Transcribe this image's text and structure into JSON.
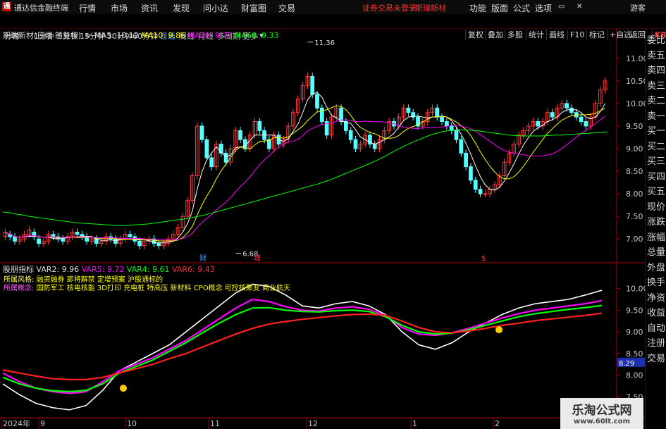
{
  "app": {
    "logo": "通",
    "title": "通达信金融终端",
    "menu": [
      "行情",
      "市场",
      "资讯",
      "发现",
      "问小达",
      "财富圈",
      "交易"
    ],
    "warning": "证券交易未登录",
    "stock_name_top": "斯瑞新材",
    "right_menu": [
      "功能",
      "版面",
      "公式",
      "选项"
    ],
    "guest": "游客"
  },
  "toolbar": {
    "periods": [
      "分时",
      "1分钟",
      "5分钟",
      "15分钟",
      "30分钟",
      "60分钟",
      "日线",
      "周线",
      "月线",
      "多周期",
      "更多"
    ],
    "active_period": "日线",
    "right_buttons": [
      "复权",
      "叠加",
      "多股",
      "统计",
      "画线",
      "F10",
      "标记",
      "+自选",
      "返回"
    ],
    "kr": "KR"
  },
  "sidebar": [
    "委比",
    "卖五",
    "卖四",
    "卖三",
    "卖二",
    "卖一",
    "买一",
    "买二",
    "买三",
    "买四",
    "买五",
    "现价",
    "涨跌",
    "涨幅",
    "总量",
    "外盘",
    "换手",
    "净资",
    "收益",
    "自动",
    "注册",
    "交易"
  ],
  "colors": {
    "up": "#ff3b3b",
    "down": "#54ffff",
    "ma5": "#ffffff",
    "ma10": "#ffff00",
    "ma20": "#ff00ff",
    "ma60": "#00ff00",
    "axis": "#b00000"
  },
  "chart_data": [
    {
      "type": "candlestick",
      "title": "斯瑞新材(日线 前复权)",
      "legend": [
        {
          "label": "MA5: 10.12",
          "color": "#ffffff"
        },
        {
          "label": "MA10: 9.86",
          "color": "#ffff00"
        },
        {
          "label": "MA20: 9.77",
          "color": "#ff00ff"
        },
        {
          "label": "MA60: 9.33",
          "color": "#00ff00"
        }
      ],
      "ylim": [
        6.55,
        11.45
      ],
      "y_ticks": [
        "11.00",
        "10.50",
        "10.00",
        "9.50",
        "9.00",
        "8.50",
        "8.00",
        "7.50",
        "7.00"
      ],
      "y_tick_values": [
        11.0,
        10.5,
        10.0,
        9.5,
        9.0,
        8.5,
        8.0,
        7.5,
        7.0
      ],
      "annotations": [
        {
          "text": "11.36",
          "price": 11.36
        },
        {
          "text": "6.68",
          "price": 6.68
        }
      ],
      "markers": [
        "财",
        "增",
        "$"
      ],
      "closes": [
        7.15,
        7.05,
        6.95,
        7.0,
        7.1,
        7.2,
        7.05,
        6.9,
        6.95,
        7.1,
        7.05,
        7.0,
        6.95,
        7.05,
        7.15,
        7.1,
        7.05,
        6.95,
        7.0,
        6.9,
        6.95,
        7.05,
        7.0,
        6.9,
        7.0,
        7.1,
        7.05,
        6.95,
        6.85,
        6.95,
        7.0,
        6.9,
        6.85,
        6.9,
        7.0,
        7.1,
        7.25,
        7.5,
        7.85,
        8.4,
        9.5,
        9.2,
        8.8,
        8.6,
        9.1,
        8.9,
        8.7,
        9.0,
        9.4,
        9.2,
        9.0,
        9.3,
        9.6,
        9.4,
        9.2,
        9.0,
        9.3,
        9.1,
        9.2,
        9.5,
        9.8,
        10.1,
        10.4,
        10.6,
        10.2,
        9.9,
        9.6,
        9.3,
        9.7,
        9.9,
        9.6,
        9.4,
        9.2,
        9.0,
        9.1,
        9.3,
        9.1,
        9.0,
        9.2,
        9.4,
        9.6,
        9.5,
        9.7,
        9.9,
        9.8,
        9.7,
        9.5,
        9.6,
        9.8,
        9.9,
        9.7,
        9.6,
        9.5,
        9.4,
        9.2,
        8.9,
        8.6,
        8.3,
        8.1,
        8.0,
        8.0,
        8.1,
        8.2,
        8.4,
        8.7,
        8.9,
        9.1,
        9.3,
        9.4,
        9.5,
        9.6,
        9.5,
        9.6,
        9.8,
        9.7,
        9.9,
        10.0,
        9.9,
        9.8,
        9.7,
        9.6,
        9.5,
        9.7,
        10.0,
        10.3,
        10.5
      ],
      "opens": [
        7.05,
        7.1,
        7.05,
        6.95,
        7.0,
        7.1,
        7.15,
        7.0,
        6.9,
        6.95,
        7.1,
        7.05,
        7.0,
        6.95,
        7.05,
        7.15,
        7.1,
        7.05,
        6.95,
        7.0,
        6.9,
        6.95,
        7.05,
        7.0,
        6.9,
        7.0,
        7.1,
        7.05,
        6.95,
        6.85,
        6.95,
        7.0,
        6.9,
        6.85,
        6.9,
        7.0,
        7.1,
        7.25,
        7.5,
        7.85,
        8.4,
        9.5,
        9.2,
        8.8,
        8.6,
        9.1,
        8.9,
        8.7,
        9.0,
        9.4,
        9.2,
        9.0,
        9.3,
        9.6,
        9.4,
        9.2,
        9.0,
        9.3,
        9.1,
        9.2,
        9.5,
        9.8,
        10.1,
        10.4,
        10.6,
        10.2,
        9.9,
        9.6,
        9.3,
        9.7,
        9.9,
        9.6,
        9.4,
        9.2,
        9.0,
        9.1,
        9.3,
        9.1,
        9.0,
        9.2,
        9.4,
        9.6,
        9.5,
        9.7,
        9.9,
        9.8,
        9.7,
        9.5,
        9.6,
        9.8,
        9.9,
        9.7,
        9.6,
        9.5,
        9.4,
        9.2,
        8.9,
        8.6,
        8.3,
        8.1,
        8.0,
        8.0,
        8.1,
        8.2,
        8.4,
        8.7,
        8.9,
        9.1,
        9.3,
        9.4,
        9.5,
        9.6,
        9.5,
        9.6,
        9.8,
        9.7,
        9.9,
        10.0,
        9.9,
        9.8,
        9.7,
        9.6,
        9.5,
        9.7,
        10.0,
        10.3
      ],
      "ma60": [
        7.6,
        7.58,
        7.55,
        7.53,
        7.5,
        7.48,
        7.46,
        7.44,
        7.42,
        7.4,
        7.38,
        7.36,
        7.35,
        7.34,
        7.33,
        7.32,
        7.31,
        7.3,
        7.3,
        7.3,
        7.31,
        7.32,
        7.33,
        7.35,
        7.37,
        7.39,
        7.41,
        7.43,
        7.45,
        7.48,
        7.51,
        7.54,
        7.58,
        7.62,
        7.66,
        7.7,
        7.74,
        7.78,
        7.82,
        7.86,
        7.9,
        7.94,
        7.98,
        8.02,
        8.06,
        8.1,
        8.14,
        8.18,
        8.22,
        8.27,
        8.32,
        8.38,
        8.44,
        8.5,
        8.56,
        8.62,
        8.68,
        8.75,
        8.82,
        8.9,
        8.98,
        9.05,
        9.12,
        9.18,
        9.24,
        9.3,
        9.34,
        9.38,
        9.4,
        9.42,
        9.42,
        9.41,
        9.4,
        9.38,
        9.36,
        9.34,
        9.32,
        9.3,
        9.29,
        9.28,
        9.28,
        9.28,
        9.28,
        9.29,
        9.3,
        9.3,
        9.31,
        9.32,
        9.33,
        9.34,
        9.35,
        9.36,
        9.37
      ]
    },
    {
      "type": "line",
      "title": "股朋指标",
      "legend": [
        {
          "label": "VAR2: 9.96",
          "color": "#ffffff"
        },
        {
          "label": "VAR5: 9.72",
          "color": "#ff00ff"
        },
        {
          "label": "VAR4: 9.61",
          "color": "#00ff00"
        },
        {
          "label": "VAR6: 9.43",
          "color": "#ff2020"
        }
      ],
      "ylim": [
        7.1,
        10.4
      ],
      "y_ticks": [
        "10.00",
        "9.50",
        "9.00",
        "8.50",
        "8.00",
        "7.50"
      ],
      "y_tick_values": [
        10.0,
        9.5,
        9.0,
        8.5,
        8.0,
        7.5
      ],
      "current_value": "8.29",
      "info_lines": [
        {
          "label": "所属风格:",
          "value": "融资融券 即将解禁 定增预案 沪股通标的"
        },
        {
          "label": "所属概念:",
          "value": "国防军工 核电核能 3D打印 充电桩 特高压 新材料 CPO概念 可控核聚变 商业航天"
        }
      ],
      "x_ticks": [
        "2024年",
        "9",
        "10",
        "11",
        "12",
        "1",
        "2"
      ],
      "series": [
        {
          "name": "VAR2",
          "values": [
            7.8,
            7.55,
            7.35,
            7.25,
            7.2,
            7.3,
            7.65,
            8.1,
            8.3,
            8.5,
            8.7,
            9.0,
            9.3,
            9.6,
            9.9,
            10.1,
            10.05,
            9.85,
            9.6,
            9.55,
            9.65,
            9.7,
            9.6,
            9.4,
            9.0,
            8.7,
            8.6,
            8.75,
            9.0,
            9.2,
            9.4,
            9.55,
            9.65,
            9.7,
            9.75,
            9.85,
            9.96
          ]
        },
        {
          "name": "VAR5",
          "values": [
            8.05,
            7.85,
            7.7,
            7.62,
            7.58,
            7.62,
            7.85,
            8.1,
            8.25,
            8.4,
            8.6,
            8.8,
            9.05,
            9.3,
            9.55,
            9.75,
            9.7,
            9.58,
            9.5,
            9.48,
            9.55,
            9.58,
            9.52,
            9.38,
            9.1,
            8.95,
            8.92,
            8.98,
            9.08,
            9.2,
            9.32,
            9.42,
            9.5,
            9.55,
            9.6,
            9.65,
            9.72
          ]
        },
        {
          "name": "VAR4",
          "values": [
            7.95,
            7.8,
            7.7,
            7.64,
            7.62,
            7.65,
            7.8,
            8.05,
            8.2,
            8.35,
            8.55,
            8.75,
            8.98,
            9.2,
            9.4,
            9.55,
            9.56,
            9.5,
            9.47,
            9.46,
            9.49,
            9.5,
            9.47,
            9.35,
            9.15,
            9.0,
            8.95,
            8.97,
            9.05,
            9.15,
            9.25,
            9.35,
            9.42,
            9.47,
            9.52,
            9.56,
            9.61
          ]
        },
        {
          "name": "VAR6",
          "values": [
            8.12,
            8.05,
            7.98,
            7.92,
            7.9,
            7.9,
            7.95,
            8.05,
            8.15,
            8.25,
            8.38,
            8.5,
            8.65,
            8.8,
            8.95,
            9.08,
            9.18,
            9.24,
            9.29,
            9.33,
            9.37,
            9.4,
            9.41,
            9.38,
            9.25,
            9.1,
            9.0,
            8.98,
            9.02,
            9.08,
            9.15,
            9.2,
            9.26,
            9.3,
            9.34,
            9.38,
            9.43
          ]
        }
      ]
    }
  ],
  "watermark": {
    "line1": "乐淘公式网",
    "line2": "www.60lt.com"
  }
}
